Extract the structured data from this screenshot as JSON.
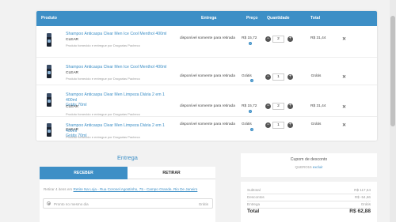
{
  "cart": {
    "headers": {
      "produto": "Produto",
      "entrega": "Entrega",
      "preco": "Preço",
      "quantidade": "Quantidade",
      "total": "Total"
    },
    "items": [
      {
        "name_lines": [
          "Shampoo Anticaspa Clear Men Ice Cool Menthol 400ml"
        ],
        "brand": "CLEAR",
        "seller": "Produto fornecido e entregue por Drogarias Pacheco",
        "availability": "disponível somente para retirada",
        "price": "R$ 15,72",
        "qty": "2",
        "total": "R$ 31,44"
      },
      {
        "name_lines": [
          "Shampoo Anticaspa Clear Men Ice Cool Menthol 400ml"
        ],
        "brand": "CLEAR",
        "seller": "Produto fornecido e entregue por Drogarias Pacheco",
        "availability": "disponível somente para retirada",
        "price": "Grátis",
        "qty": "1",
        "total": "Grátis"
      },
      {
        "name_lines": [
          "Shampoo Anticaspa Clear Men Limpeza Diária 2 em 1 400ml",
          "Grátis 70ml"
        ],
        "brand": "CLEAR",
        "seller": "Produto fornecido e entregue por Drogarias Pacheco",
        "availability": "disponível somente para retirada",
        "price": "R$ 15,72",
        "qty": "2",
        "total": "R$ 31,44"
      },
      {
        "name_lines": [
          "Shampoo Anticaspa Clear Men Limpeza Diária 2 em 1 400ml",
          "Grátis 70ml"
        ],
        "brand": "CLEAR",
        "seller": "Produto fornecido e entregue por Drogarias Pacheco",
        "availability": "disponível somente para retirada",
        "price": "Grátis",
        "qty": "1",
        "total": "Grátis"
      }
    ],
    "info_icon": "info-icon",
    "minus_symbol": "−",
    "plus_symbol": "+",
    "remove_symbol": "✕"
  },
  "delivery": {
    "title": "Entrega",
    "tabs": {
      "receber": "RECEBER",
      "retirar": "RETIRAR"
    },
    "pickup_prefix": "Retirar 4 itens em",
    "pickup_address": "Retire Na Loja - Rua Coronel Agostinho, 75 - Campo Grande, Rio De Janeiro",
    "option_label": "Pronto no mesmo dia",
    "option_price": "Grátis"
  },
  "coupon": {
    "title": "Cupom de desconto",
    "code": "QUERO15",
    "remove_label": "excluir"
  },
  "summary": {
    "subtotal_label": "Subtotal",
    "subtotal_value": "R$ 117,54",
    "descontos_label": "Descontos",
    "descontos_value": "R$ -54,66",
    "entrega_label": "Entrega",
    "entrega_value": "Grátis",
    "total_label": "Total",
    "total_value": "R$ 62,88"
  },
  "colors": {
    "accent": "#3d8fc6",
    "background": "#f2f2f2"
  }
}
